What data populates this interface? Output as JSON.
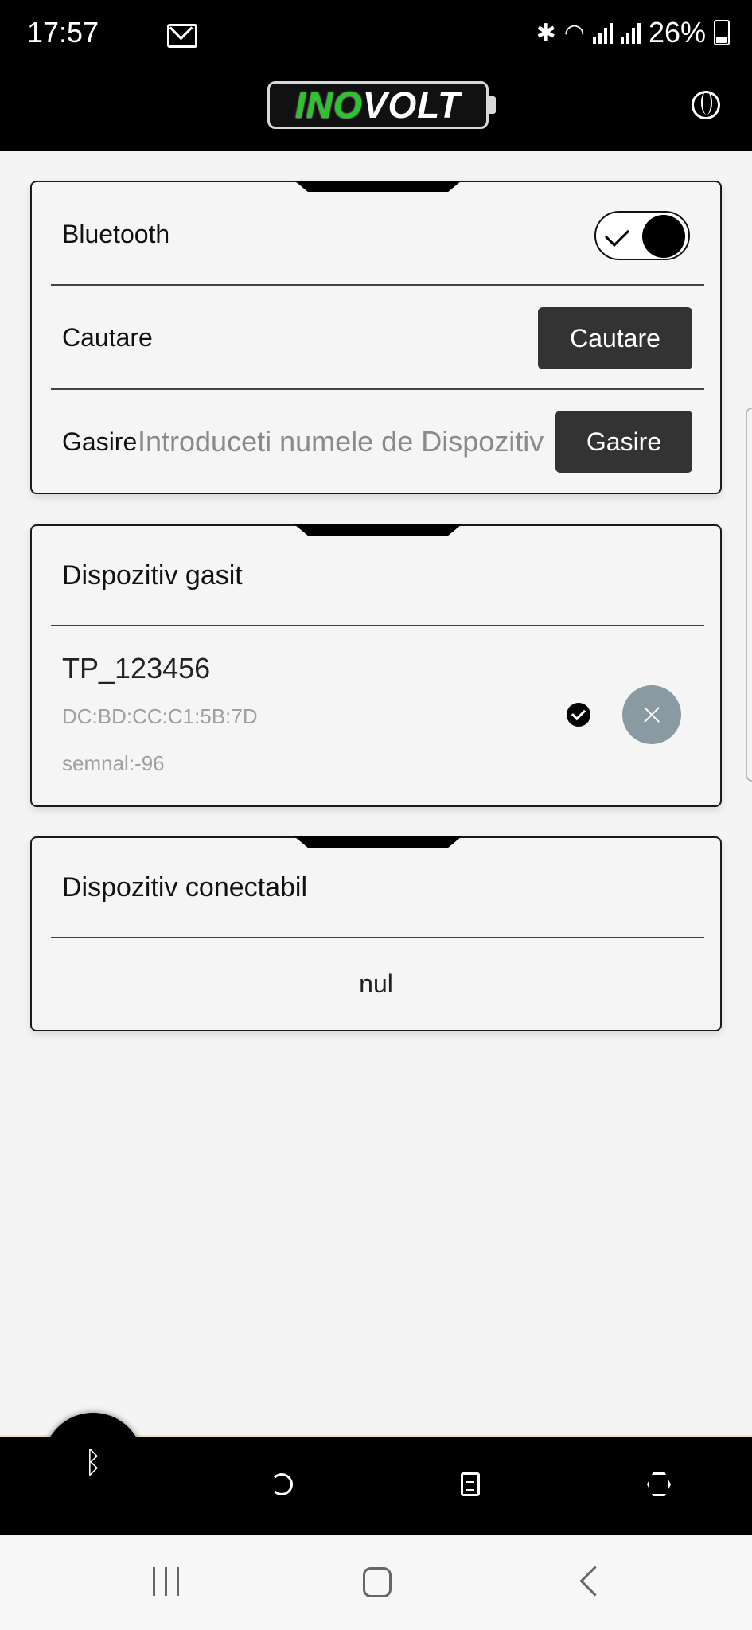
{
  "status_bar": {
    "time": "17:57",
    "battery": "26%"
  },
  "app_header": {
    "logo_part1": "INO",
    "logo_part2": "VOLT"
  },
  "connection_card": {
    "bluetooth_label": "Bluetooth",
    "bluetooth_enabled": true,
    "search_label": "Cautare",
    "search_button": "Cautare",
    "find_label": "Gasire",
    "find_placeholder": "Introduceti numele de Dispozitiv",
    "find_button": "Gasire"
  },
  "found_card": {
    "title": "Dispozitiv gasit",
    "device": {
      "name": "TP_123456",
      "mac": "DC:BD:CC:C1:5B:7D",
      "signal": "semnal:-96"
    }
  },
  "connectable_card": {
    "title": "Dispozitiv conectabil",
    "empty_text": "nul"
  },
  "bottom_nav": {
    "items": [
      "bluetooth-icon",
      "refresh-icon",
      "document-icon",
      "settings-icon"
    ]
  },
  "colors": {
    "accent_green": "#2ac52a",
    "dark_button": "#333333",
    "close_button": "#8a9aa3"
  }
}
